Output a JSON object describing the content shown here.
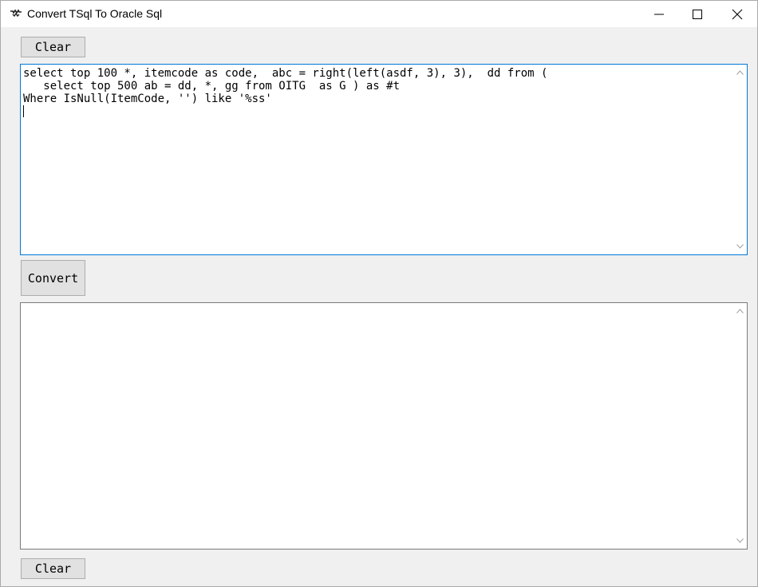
{
  "window": {
    "title": "Convert TSql To Oracle Sql"
  },
  "buttons": {
    "clear_top": "Clear",
    "convert": "Convert",
    "clear_bottom": "Clear"
  },
  "input": {
    "lines": [
      "select top 100 *, itemcode as code,  abc = right(left(asdf, 3), 3),  dd from (",
      "   select top 500 ab = dd, *, gg from OITG  as G ) as #t",
      "Where IsNull(ItemCode, '') like '%ss'"
    ]
  },
  "output": {
    "text": ""
  },
  "icons": {
    "app": "app-icon",
    "minimize": "minimize-icon",
    "maximize": "maximize-icon",
    "close": "close-icon",
    "scroll_up": "chevron-up-icon",
    "scroll_down": "chevron-down-icon"
  },
  "colors": {
    "titlebar": "#ffffff",
    "window_bg": "#f0f0f0",
    "focus_border": "#0078d7",
    "button_bg": "#e1e1e1"
  }
}
